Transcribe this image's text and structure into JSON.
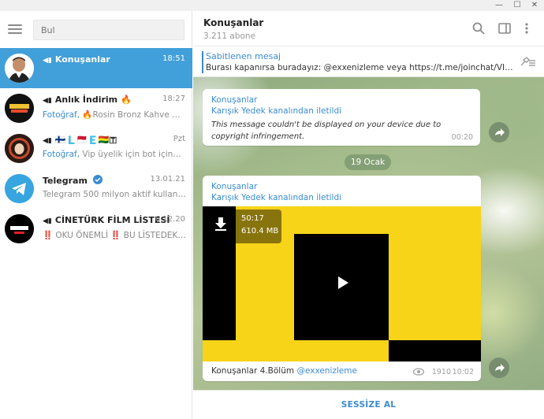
{
  "search": {
    "placeholder": "Bul"
  },
  "chats": [
    {
      "name": "Konuşanlar",
      "time": "18:51",
      "preview": ""
    },
    {
      "name": "Anlık İndirim 🔥",
      "time": "18:27",
      "preview_prefix": "Fotoğraf,",
      "preview_text": " 🔥Rosin Bronz Kahve Gra..."
    },
    {
      "name": "🇫🇮🇱🇲🇨🇪🇧🇴🇹",
      "time": "Pzt",
      "preview_prefix": "Fotoğraf,",
      "preview_text": " Vip üyelik için bot içinden ..."
    },
    {
      "name": "Telegram",
      "time": "13.01.21",
      "preview_text": "Telegram 500 milyon aktif kullanıcıy..."
    },
    {
      "name": "CİNETÜRK FİLM LİSTESİ",
      "time": "6.12.20",
      "preview_text": "‼️ OKU ÖNEMLİ ‼️ BU LİSTEDEKİ..."
    }
  ],
  "header": {
    "title": "Konuşanlar",
    "subtitle": "3.211 abone"
  },
  "pinned": {
    "title": "Sabitlenen mesaj",
    "text": "Burası kapanırsa buradayız:  @exxenizleme  veya  https://t.me/joinchat/VI42..."
  },
  "messages": [
    {
      "source": "Konuşanlar",
      "forwarded": "Karışık Yedek kanalından iletildi",
      "text": "This message couldn't be displayed on your device due to copyright infringement.",
      "time": "00:20"
    },
    {
      "source": "Konuşanlar",
      "forwarded": "Karışık Yedek kanalından iletildi",
      "duration": "50:17",
      "size": "610.4 MB",
      "caption": "Konuşanlar 4.Bölüm ",
      "caption_link": "@exxenizleme",
      "views": "1910",
      "time": "10:02"
    }
  ],
  "date_separator": "19 Ocak",
  "footer": {
    "mute_label": "SESSİZE AL"
  },
  "colors": {
    "accent": "#419fd9",
    "link": "#3a8bd1",
    "video_yellow": "#f7d418"
  }
}
